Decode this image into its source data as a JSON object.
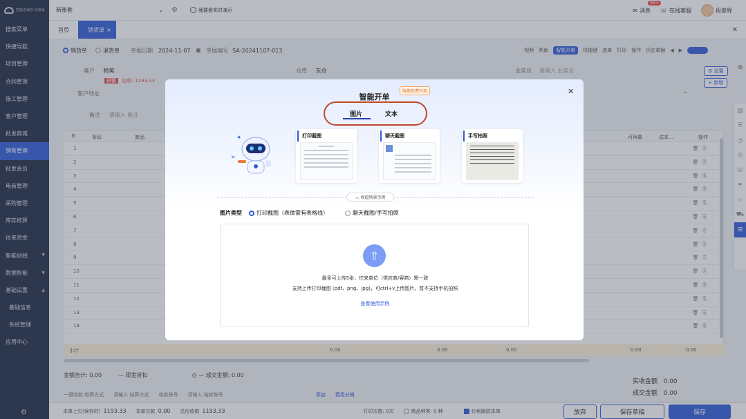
{
  "sidebar": {
    "logo_text": "智能进销存 标准版",
    "items": [
      {
        "label": "搜索菜单"
      },
      {
        "label": "快捷导航"
      },
      {
        "label": "项目管理"
      },
      {
        "label": "合同管理"
      },
      {
        "label": "施工管理"
      },
      {
        "label": "客户管理"
      },
      {
        "label": "批发商城"
      },
      {
        "label": "销售管理",
        "active": true
      },
      {
        "label": "批发会员"
      },
      {
        "label": "电商管理"
      },
      {
        "label": "采购管理"
      },
      {
        "label": "库存核算"
      },
      {
        "label": "往来资金"
      },
      {
        "label": "智能财税"
      },
      {
        "label": "数据智能"
      },
      {
        "label": "基础设置"
      },
      {
        "label": "基础信息"
      },
      {
        "label": "系统管理"
      },
      {
        "label": "应用中心"
      }
    ]
  },
  "topbar": {
    "org_select": "新账套",
    "toggle_label": "我要看实时演示",
    "dev_badge": "CCWEB 开发助手 v4.4.12 · prod",
    "message_label": "消息",
    "message_count": "99+",
    "online_service": "在线客服",
    "user_name": "段俊辉"
  },
  "tabs": [
    {
      "label": "首页"
    },
    {
      "label": "销货单",
      "active": true
    }
  ],
  "form": {
    "type_sales": "销货单",
    "type_return": "退货单",
    "date_label": "单据日期",
    "date_value": "2024-11-07",
    "no_label": "单据编号",
    "no_value": "SA-20241107-013",
    "toolbar": [
      "视频",
      "帮助",
      "智能开单",
      "快捷键",
      "选单",
      "打印",
      "操作",
      "历史单据"
    ],
    "customer_label": "客户",
    "customer_value": "物美",
    "warn_tag": "预警",
    "receivable": "应收: 1193.33",
    "warehouse_label": "仓库",
    "warehouse_value": "东仓",
    "salesman_label": "业务员",
    "salesman_placeholder": "请输入 业务员",
    "address_label": "客户地址",
    "remark_label": "备注",
    "remark_placeholder": "请输入 备注",
    "settings_btn": "设置",
    "add_btn": "+ 新增"
  },
  "table": {
    "col_code": "条码",
    "col_goods": "商品",
    "col_available": "可用量",
    "col_cost": "成本...",
    "col_ops": "操作",
    "rows": [
      "1",
      "2",
      "3",
      "4",
      "5",
      "6",
      "7",
      "8",
      "9",
      "10",
      "11",
      "12",
      "13",
      "14"
    ],
    "subtotal_label": "小计",
    "sub1": "0.00",
    "sub2": "0.00",
    "sub3": "0.00",
    "sub4": "0.00",
    "sub5": "0.00"
  },
  "summary": {
    "total_amount": "金额合计: 0.00",
    "cash_discount": "现金折扣",
    "deal_amount": "成交金额: 0.00",
    "received_label": "实收金额",
    "received_value": "0.00",
    "deal_label": "成交金额",
    "deal_value": "0.00",
    "settle": "一键收款  结算方式",
    "settle_ph": "请输入 结算方式",
    "account": "收款账号",
    "account_ph": "请输入 结款账号",
    "add": "添加",
    "more": "费用分摊"
  },
  "footer": {
    "prev_debt_label": "本单上欠(保存时)",
    "prev_debt": "1193.33",
    "this_debt_label": "本单欠款",
    "this_debt": "0.00",
    "total_recv_label": "总应收款",
    "total_recv": "1193.33",
    "print_count": "打印次数: 0次",
    "goods_types": "商品种类: 0 种",
    "price_track": "价格跟踪本单",
    "discard": "放弃",
    "save_draft": "保存草稿",
    "save": "保存"
  },
  "modal": {
    "title": "智能开单",
    "badge": "限期免费内测",
    "tab_image": "图片",
    "tab_text": "文本",
    "cards": [
      {
        "title": "打印截图"
      },
      {
        "title": "聊天截图"
      },
      {
        "title": "手写拍照"
      }
    ],
    "collapse": "收起场景示例",
    "type_label": "图片类型",
    "option_print": "打印截图（表体需有表格线）",
    "option_chat": "聊天截图/手写拍照",
    "upload_line1": "最多可上传5张，往来单位（供应商/客商）需一致",
    "upload_line2": "支持上传打印截图 (pdf、png、jpg)，可ctrl+v上传图片，暂不支持手机拍照",
    "upload_link": "查看使用示例"
  },
  "colors": {
    "accent": "#2f5bd8",
    "sidebar": "#1e2a44",
    "highlight": "#c0472f"
  }
}
